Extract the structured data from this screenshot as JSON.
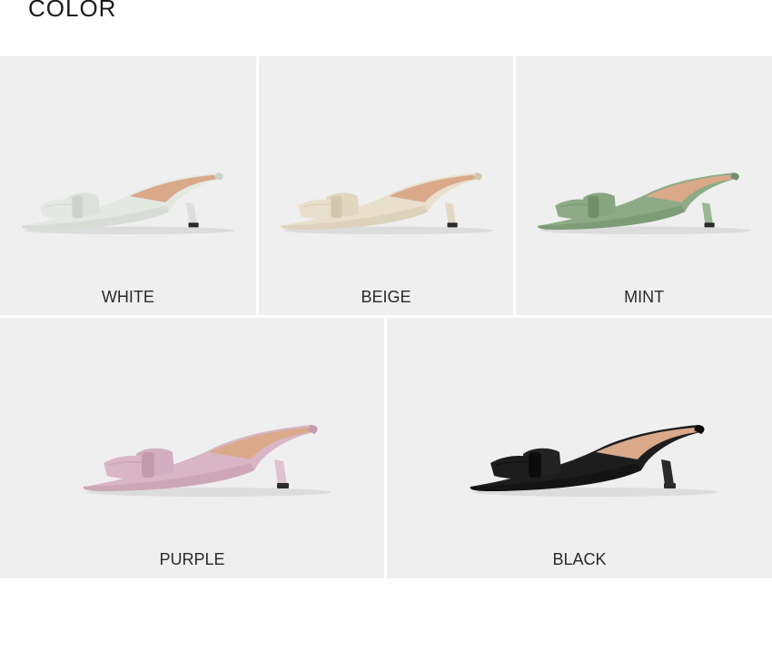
{
  "heading": "COLOR",
  "colors": [
    {
      "label": "WHITE",
      "upper": "#e4e8e3",
      "shade": "#cdd2cc",
      "bow": "#dde1dc",
      "sole": "#dbe0da"
    },
    {
      "label": "BEIGE",
      "upper": "#e9dfcd",
      "shade": "#d3c6ae",
      "bow": "#e2d6c1",
      "sole": "#e2d8c6"
    },
    {
      "label": "MINT",
      "upper": "#8dab86",
      "shade": "#728f6c",
      "bow": "#86a580",
      "sole": "#9cb795"
    },
    {
      "label": "PURPLE",
      "upper": "#d9b5c6",
      "shade": "#c39bad",
      "bow": "#d3aec0",
      "sole": "#e0c3d0"
    },
    {
      "label": "BLACK",
      "upper": "#1d1d1e",
      "shade": "#0c0c0d",
      "bow": "#232324",
      "sole": "#2a2a2b"
    }
  ]
}
